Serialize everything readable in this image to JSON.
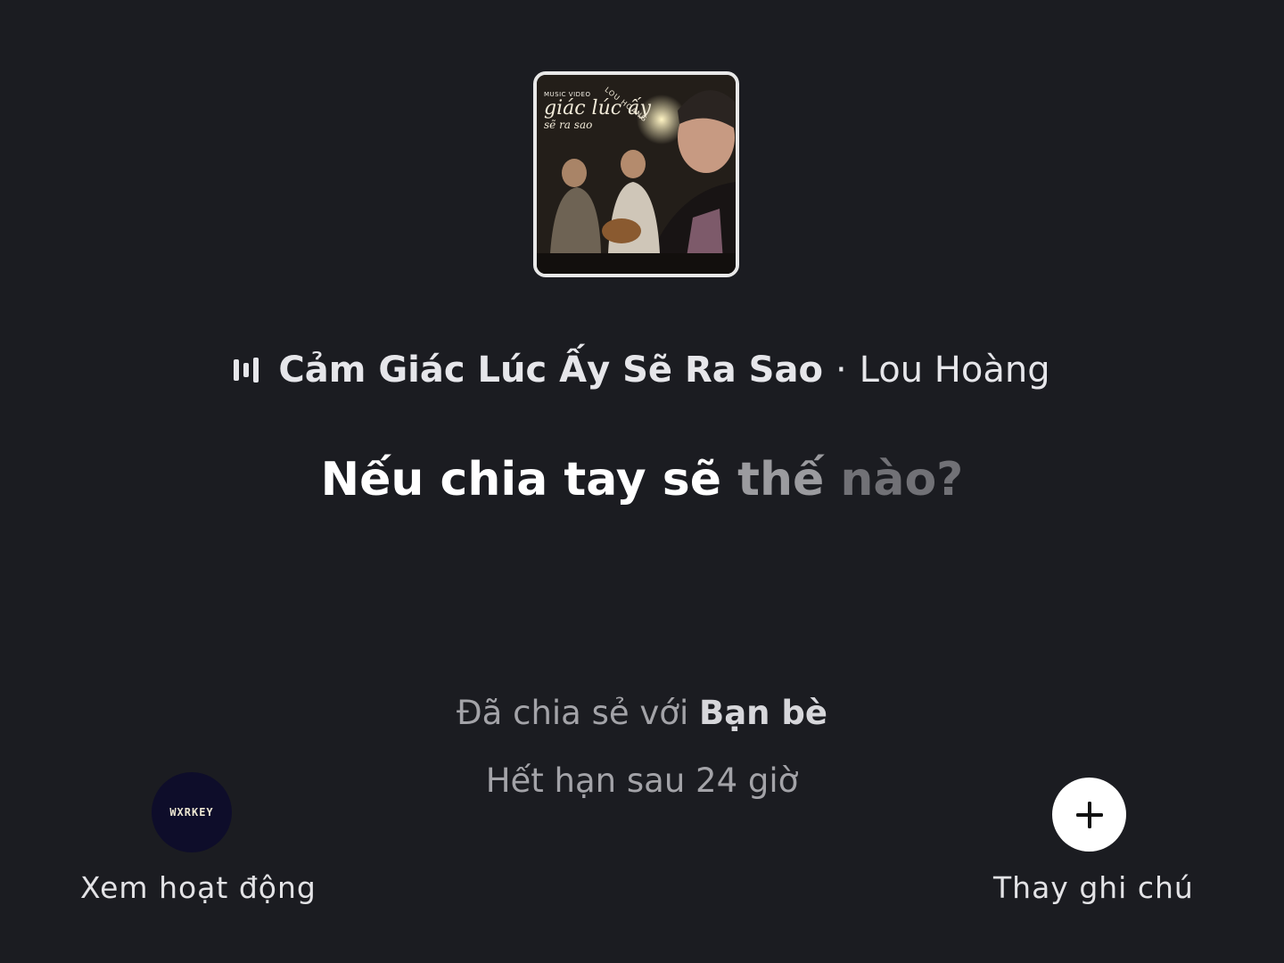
{
  "album": {
    "label_top": "MUSIC VIDEO",
    "script_title": "giác lúc ấy",
    "script_sub": "sẽ ra sao",
    "artist_stamp": "LOU HOÀNG"
  },
  "song": {
    "title": "Cảm Giác Lúc Ấy Sẽ Ra Sao",
    "separator": "·",
    "artist": "Lou Hoàng"
  },
  "lyric": {
    "sung": "Nếu chia tay sẽ ",
    "mid": "thế ",
    "pending": "nào?"
  },
  "share": {
    "prefix": "Đã chia sẻ với ",
    "audience": "Bạn bè"
  },
  "expiry": "Hết hạn sau 24 giờ",
  "actions": {
    "avatar_text": "WXRKEY",
    "view_activity": "Xem hoạt động",
    "change_note": "Thay ghi chú"
  },
  "colors": {
    "background": "#1b1c21",
    "lyric_sung": "#ffffff",
    "lyric_pending": "#717176"
  }
}
